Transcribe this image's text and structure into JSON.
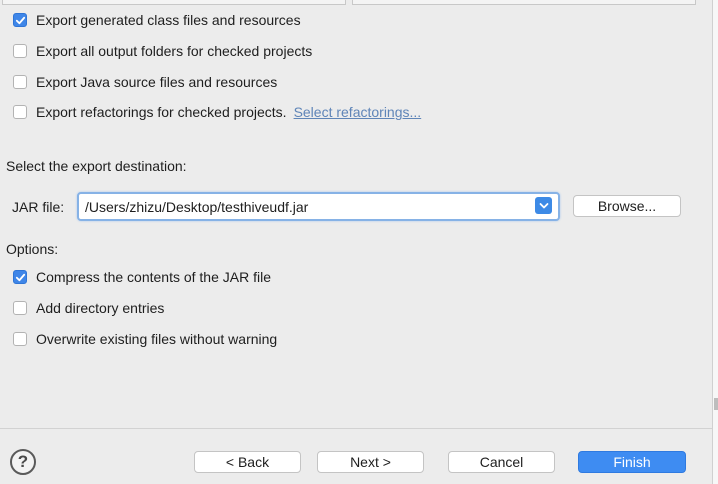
{
  "export_options": [
    {
      "label": "Export generated class files and resources",
      "checked": true
    },
    {
      "label": "Export all output folders for checked projects",
      "checked": false
    },
    {
      "label": "Export Java source files and resources",
      "checked": false
    },
    {
      "label": "Export refactorings for checked projects.",
      "checked": false,
      "link": "Select refactorings..."
    }
  ],
  "destination": {
    "heading": "Select the export destination:",
    "jar_label": "JAR file:",
    "jar_path": "/Users/zhizu/Desktop/testhiveudf.jar",
    "browse_label": "Browse..."
  },
  "options": {
    "heading": "Options:",
    "items": [
      {
        "label": "Compress the contents of the JAR file",
        "checked": true
      },
      {
        "label": "Add directory entries",
        "checked": false
      },
      {
        "label": "Overwrite existing files without warning",
        "checked": false
      }
    ]
  },
  "footer": {
    "help": "?",
    "back": "< Back",
    "next": "Next >",
    "cancel": "Cancel",
    "finish": "Finish"
  },
  "colors": {
    "accent": "#3e8cf2",
    "link": "#5f85b8",
    "background": "#ececec"
  }
}
